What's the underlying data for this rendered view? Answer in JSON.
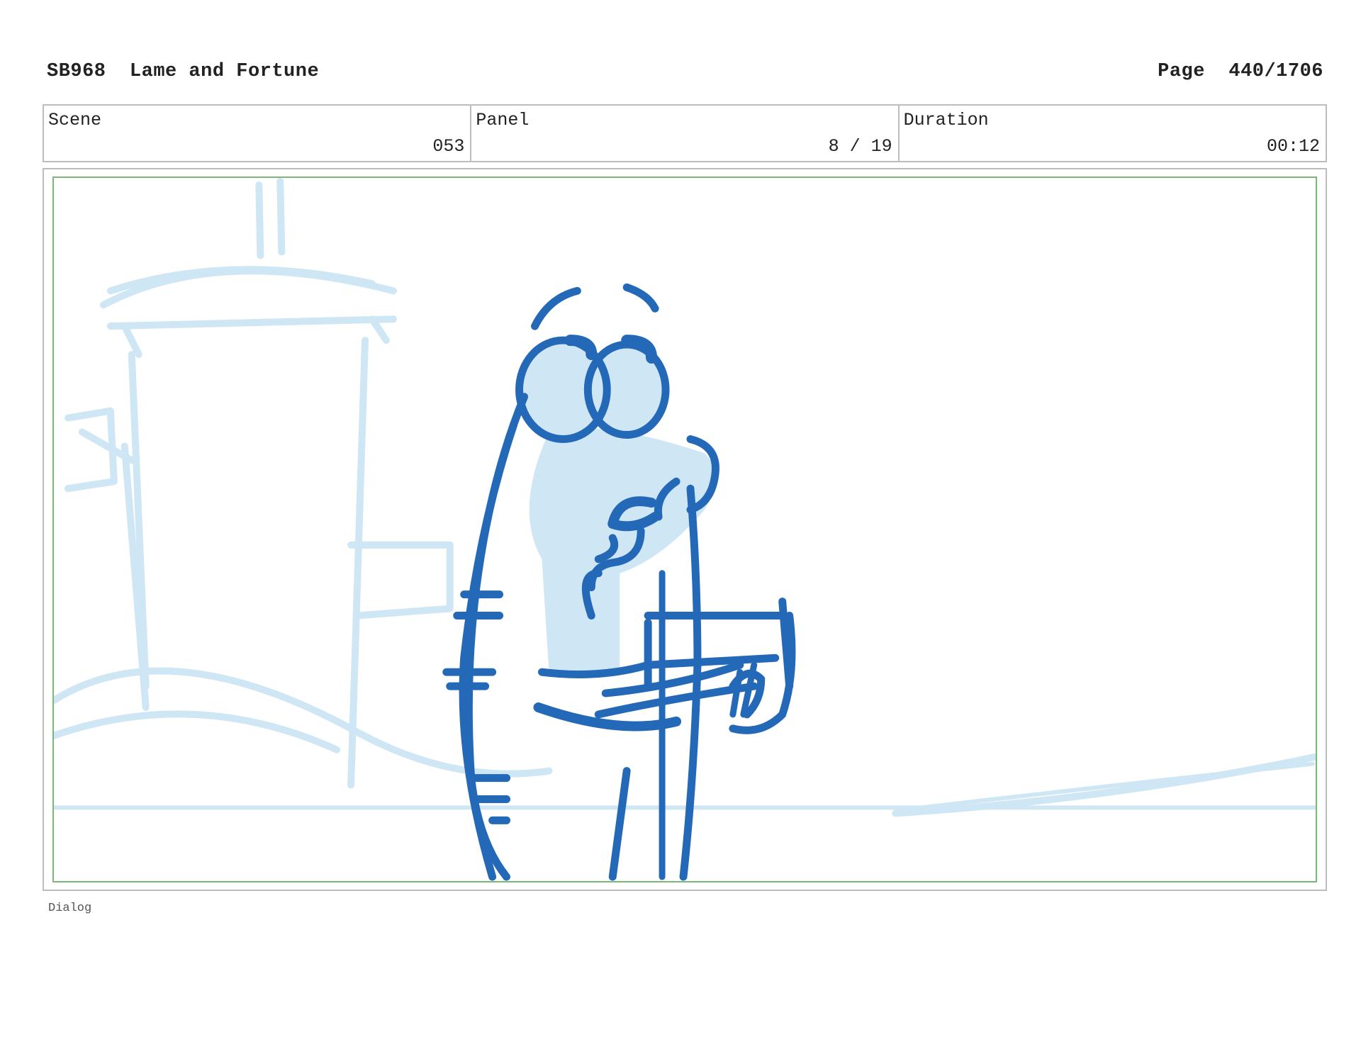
{
  "header": {
    "title": "SB968  Lame and Fortune",
    "page": "Page  440/1706"
  },
  "info": {
    "scene_label": "Scene",
    "scene_value": "053",
    "panel_label": "Panel",
    "panel_value": "8 / 19",
    "duration_label": "Duration",
    "duration_value": "00:12"
  },
  "dialog": {
    "label": "Dialog"
  },
  "colors": {
    "sketch_dark": "#2369b8",
    "sketch_light": "#cfe6f5",
    "panel_border": "#7ab87a"
  },
  "icons": {
    "frame": "storyboard-sketch-illustration"
  }
}
